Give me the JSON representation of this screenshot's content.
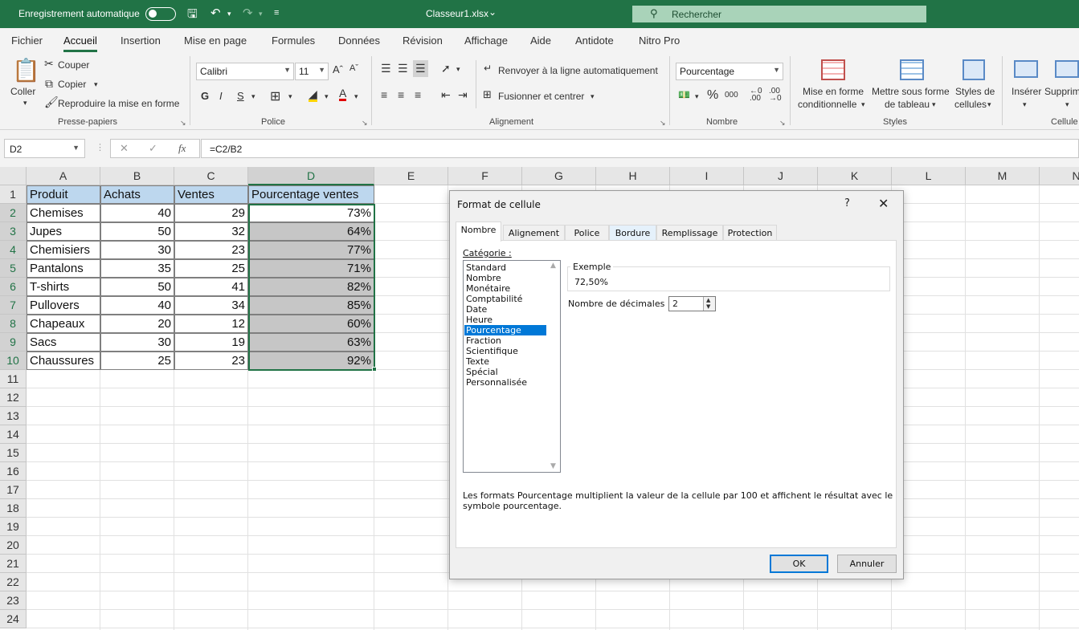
{
  "titlebar": {
    "autosave_label": "Enregistrement automatique",
    "file_name": "Classeur1.xlsx",
    "file_chevron": "⌄",
    "search_placeholder": "Rechercher"
  },
  "menu": {
    "tabs": [
      "Fichier",
      "Accueil",
      "Insertion",
      "Mise en page",
      "Formules",
      "Données",
      "Révision",
      "Affichage",
      "Aide",
      "Antidote",
      "Nitro Pro"
    ],
    "active": "Accueil"
  },
  "ribbon": {
    "clipboard": {
      "paste": "Coller",
      "cut": "Couper",
      "copy": "Copier",
      "format_painter": "Reproduire la mise en forme",
      "group": "Presse-papiers"
    },
    "font": {
      "family": "Calibri",
      "size": "11",
      "bold": "G",
      "italic": "I",
      "underline": "S",
      "group": "Police"
    },
    "alignment": {
      "wrap": "Renvoyer à la ligne automatiquement",
      "merge": "Fusionner et centrer",
      "group": "Alignement"
    },
    "number": {
      "format": "Pourcentage",
      "percent": "%",
      "thousands": "000",
      "group": "Nombre"
    },
    "styles": {
      "conditional": [
        "Mise en forme",
        "conditionnelle"
      ],
      "table": [
        "Mettre sous forme",
        "de tableau"
      ],
      "cell_styles": [
        "Styles de",
        "cellules"
      ],
      "group": "Styles"
    },
    "cells": {
      "insert": "Insérer",
      "delete": "Supprim",
      "group": "Cellule"
    }
  },
  "formula_bar": {
    "name_box": "D2",
    "fx": "fx",
    "formula": "=C2/B2"
  },
  "sheet": {
    "columns": [
      "A",
      "B",
      "C",
      "D",
      "E",
      "F",
      "G",
      "H",
      "I",
      "J",
      "K",
      "L",
      "M",
      "N"
    ],
    "rows": [
      "1",
      "2",
      "3",
      "4",
      "5",
      "6",
      "7",
      "8",
      "9",
      "10",
      "11",
      "12",
      "13",
      "14",
      "15",
      "16",
      "17",
      "18",
      "19",
      "20",
      "21",
      "22",
      "23",
      "24"
    ],
    "headers": [
      "Produit",
      "Achats",
      "Ventes",
      "Pourcentage ventes"
    ],
    "data": [
      [
        "Chemises",
        "40",
        "29",
        "73%"
      ],
      [
        "Jupes",
        "50",
        "32",
        "64%"
      ],
      [
        "Chemisiers",
        "30",
        "23",
        "77%"
      ],
      [
        "Pantalons",
        "35",
        "25",
        "71%"
      ],
      [
        "T-shirts",
        "50",
        "41",
        "82%"
      ],
      [
        "Pullovers",
        "40",
        "34",
        "85%"
      ],
      [
        "Chapeaux",
        "20",
        "12",
        "60%"
      ],
      [
        "Sacs",
        "30",
        "19",
        "63%"
      ],
      [
        "Chaussures",
        "25",
        "23",
        "92%"
      ]
    ]
  },
  "dialog": {
    "title": "Format de cellule",
    "help": "?",
    "close": "✕",
    "tabs": [
      "Nombre",
      "Alignement",
      "Police",
      "Bordure",
      "Remplissage",
      "Protection"
    ],
    "active_tab": "Nombre",
    "category_label": "Catégorie :",
    "categories": [
      "Standard",
      "Nombre",
      "Monétaire",
      "Comptabilité",
      "Date",
      "Heure",
      "Pourcentage",
      "Fraction",
      "Scientifique",
      "Texte",
      "Spécial",
      "Personnalisée"
    ],
    "selected_category": "Pourcentage",
    "example_label": "Exemple",
    "example_value": "72,50%",
    "decimals_label": "Nombre de décimales :",
    "decimals_value": "2",
    "description_line1": "Les formats Pourcentage multiplient la valeur de la cellule par 100 et affichent le résultat avec le",
    "description_line2": "symbole pourcentage.",
    "ok": "OK",
    "cancel": "Annuler"
  }
}
